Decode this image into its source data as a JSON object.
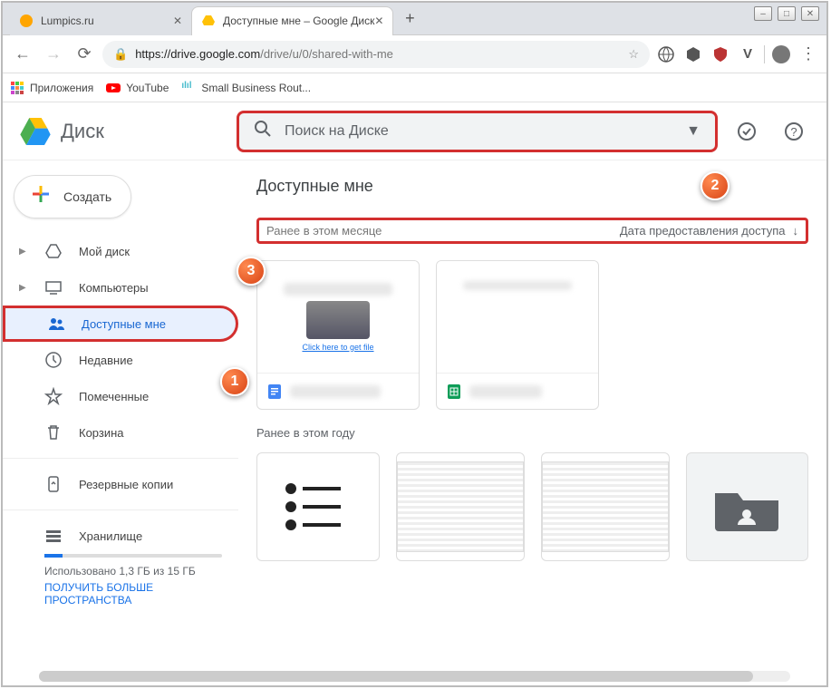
{
  "window": {
    "minimize": "–",
    "maximize": "□",
    "close": "✕"
  },
  "tabs": {
    "items": [
      {
        "title": "Lumpics.ru"
      },
      {
        "title": "Доступные мне – Google Диск"
      }
    ],
    "newtab": "+"
  },
  "addressbar": {
    "host": "https://drive.google.com",
    "path": "/drive/u/0/shared-with-me",
    "star": "☆"
  },
  "bookmarks": {
    "apps": "Приложения",
    "youtube": "YouTube",
    "sbr": "Small Business Rout..."
  },
  "drive": {
    "title": "Диск",
    "search_placeholder": "Поиск на Диске"
  },
  "create": {
    "label": "Создать"
  },
  "sidebar": {
    "items": [
      {
        "label": "Мой диск"
      },
      {
        "label": "Компьютеры"
      },
      {
        "label": "Доступные мне"
      },
      {
        "label": "Недавние"
      },
      {
        "label": "Помеченные"
      },
      {
        "label": "Корзина"
      }
    ],
    "backups": "Резервные копии",
    "storage": {
      "title": "Хранилище",
      "used": "Использовано 1,3 ГБ из 15 ГБ",
      "link": "ПОЛУЧИТЬ БОЛЬШЕ ПРОСТРАНСТВА"
    }
  },
  "main": {
    "page_title": "Доступные мне",
    "section1": "Ранее в этом месяце",
    "sort_label": "Дата предоставления доступа",
    "preview_link": "Click here to get file",
    "section2": "Ранее в этом году"
  },
  "callouts": {
    "c1": "1",
    "c2": "2",
    "c3": "3"
  }
}
